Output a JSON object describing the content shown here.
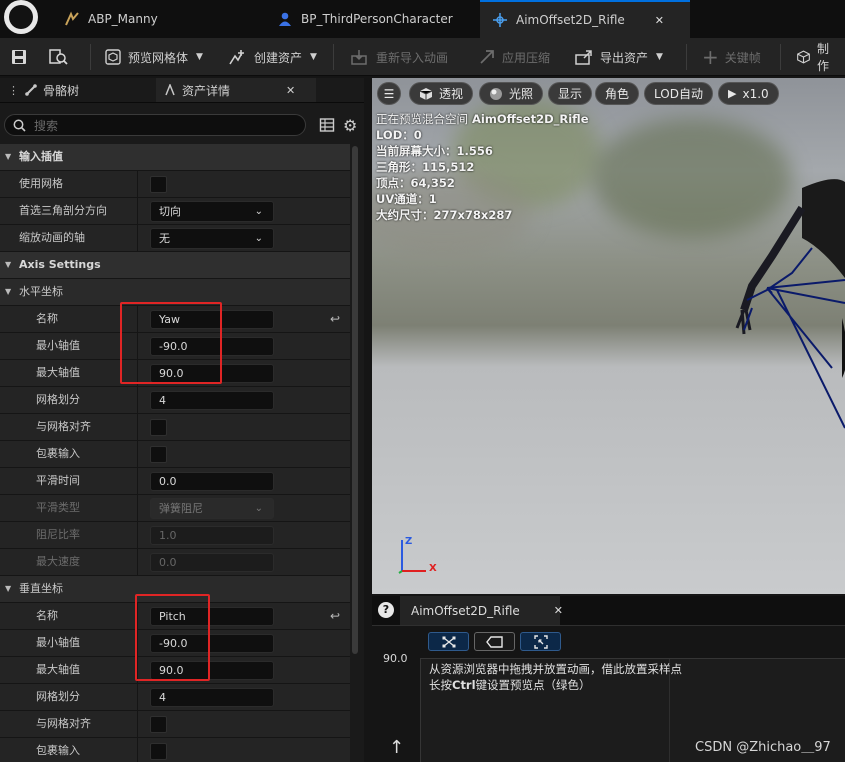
{
  "tabs": [
    {
      "label": "ABP_Manny",
      "icon": "anim-blueprint-icon"
    },
    {
      "label": "BP_ThirdPersonCharacter",
      "icon": "blueprint-person-icon"
    },
    {
      "label": "AimOffset2D_Rifle",
      "icon": "aim-offset-icon",
      "active": true,
      "close": "✕"
    }
  ],
  "toolbar": {
    "preview_mesh": "预览网格体",
    "create_asset": "创建资产",
    "reimport": "重新导入动画",
    "apply_compress": "应用压缩",
    "export_asset": "导出资产",
    "keyframe": "关键帧",
    "make": "制作"
  },
  "left_panel": {
    "tab_skeleton": "骨骼树",
    "tab_details": "资产详情",
    "tab_close": "✕",
    "search_placeholder": "搜索"
  },
  "details": {
    "input_interp": "输入插值",
    "use_grid": "使用网格",
    "preferred_tri_dir": "首选三角剖分方向",
    "preferred_tri_value": "切向",
    "scale_axis": "缩放动画的轴",
    "scale_axis_value": "无",
    "axis_settings": "Axis Settings",
    "horizontal": "水平坐标",
    "vertical": "垂直坐标",
    "name": "名称",
    "min_axis": "最小轴值",
    "max_axis": "最大轴值",
    "grid_div": "网格划分",
    "snap_grid": "与网格对齐",
    "wrap_input": "包裹输入",
    "smooth_time": "平滑时间",
    "smooth_type": "平滑类型",
    "smooth_type_value": "弹簧阻尼",
    "damping": "阻尼比率",
    "max_speed": "最大速度",
    "h": {
      "name": "Yaw",
      "min": "-90.0",
      "max": "90.0",
      "grid": "4",
      "smooth": "0.0",
      "damping": "1.0",
      "speed": "0.0"
    },
    "v": {
      "name": "Pitch",
      "min": "-90.0",
      "max": "90.0",
      "grid": "4"
    }
  },
  "viewport": {
    "menu": "☰",
    "perspective": "透视",
    "lit": "光照",
    "show": "显示",
    "character": "角色",
    "lod": "LOD自动",
    "speed": "x1.0",
    "stats": {
      "previewing": "正在预览混合空间",
      "asset": "AimOffset2D_Rifle",
      "lod": "LOD：0",
      "screen_size": "当前屏幕大小：1.556",
      "triangles": "三角形：115,512",
      "vertices": "顶点：64,352",
      "uv": "UV通道：1",
      "approx_size": "大约尺寸：277x78x287"
    },
    "axis_z": "Z",
    "axis_x": "X"
  },
  "blendspace": {
    "help": "?",
    "tab": "AimOffset2D_Rifle",
    "tab_close": "✕",
    "y_value": "90.0",
    "hint1": "从资源浏览器中拖拽并放置动画，借此放置采样点",
    "hint2_a": "长按",
    "hint2_b": "Ctrl",
    "hint2_c": "键设置预览点（绿色）"
  },
  "watermark": "CSDN @Zhichao＿97",
  "colors": {
    "accent": "#0070e0",
    "highlight_box": "#e02525",
    "axis_x": "#e02020",
    "axis_z": "#2a5ae0",
    "skeleton": "#0a1a6a"
  }
}
